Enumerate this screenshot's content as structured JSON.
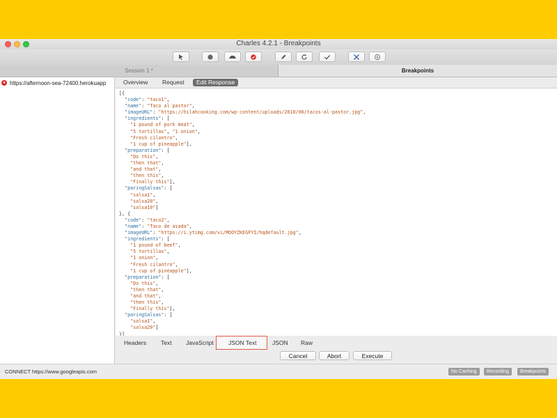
{
  "window": {
    "title": "Charles 4.2.1 - Breakpoints",
    "toolbar_icons": [
      "pointer-icon",
      "record-icon",
      "throttle-icon",
      "breakpoint-icon",
      "edit-icon",
      "repeat-icon",
      "validate-icon",
      "tools-icon",
      "settings-icon"
    ]
  },
  "tabs": {
    "session": "Session 1 *",
    "breakpoints": "Breakpoints"
  },
  "sidebar": {
    "items": [
      {
        "label": "https://afternoon-sea-72400.herokuapp"
      }
    ]
  },
  "detail_tabs": {
    "overview": "Overview",
    "request": "Request",
    "edit_response": "Edit Response",
    "active": "Edit Response"
  },
  "editor": {
    "lines": [
      "[{",
      "  \"code\": \"taco1\",",
      "  \"name\": \"Taco al pastor\",",
      "  \"imageURL\": \"https://hilahcooking.com/wp-content/uploads/2010/06/tacos-al-pastor.jpg\",",
      "  \"ingredients\": [",
      "    \"1 pound of pork meat\",",
      "    \"5 tortillas\", \"1 onion\",",
      "    \"Fresh cilantro\",",
      "    \"1 cup of pineapple\"],",
      "  \"preparation\": [",
      "    \"Do this\",",
      "    \"then that\",",
      "    \"and that\",",
      "    \"then this\",",
      "    \"Finally this\"],",
      "  \"paringSalsas\": [",
      "    \"salsa1\",",
      "    \"salsa20\",",
      "    \"salsa10\"]",
      "}, {",
      "  \"code\": \"taco2\",",
      "  \"name\": \"Taco de asada\",",
      "  \"imageURL\": \"https://i.ytimg.com/vi/MOOYZKEGFYI/hqdefault.jpg\",",
      "  \"ingredients\": [",
      "    \"1 pound of beef\",",
      "    \"5 tortillas\",",
      "    \"1 onion\",",
      "    \"Fresh cilantro\",",
      "    \"1 cup of pineapple\"],",
      "  \"preparation\": [",
      "    \"Do this\",",
      "    \"then that\",",
      "    \"and that\",",
      "    \"then this\",",
      "    \"Finally this\"],",
      "  \"paringSalsas\": [",
      "    \"salsa1\",",
      "    \"salsa20\"]",
      "}]"
    ]
  },
  "format_tabs": [
    "Headers",
    "Text",
    "JavaScript",
    "JSON Text",
    "JSON",
    "Raw"
  ],
  "format_selected": "JSON Text",
  "actions": {
    "cancel": "Cancel",
    "abort": "Abort",
    "execute": "Execute"
  },
  "status": {
    "text": "CONNECT https://www.googleapis.com",
    "no_caching": "No Caching",
    "recording": "Recording",
    "breakpoints": "Breakpoints"
  },
  "colors": {
    "background": "#ffcc00",
    "json_key": "#2f6e9f",
    "json_string": "#b75418",
    "highlight": "#e05a4e"
  }
}
